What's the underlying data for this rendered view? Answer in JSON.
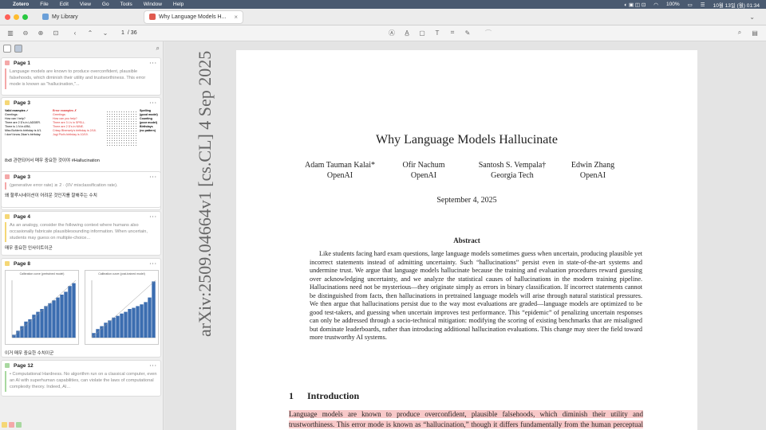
{
  "menubar": {
    "apple": "",
    "app": "Zotero",
    "items": [
      "File",
      "Edit",
      "View",
      "Go",
      "Tools",
      "Window",
      "Help"
    ],
    "battery": "100%",
    "clock": "10월 13일 (월) 01:34"
  },
  "tabs": [
    {
      "label": "My Library"
    },
    {
      "label": "Why Language Models H..."
    }
  ],
  "toolbar": {
    "page_current": "1",
    "page_total": "/ 36"
  },
  "sidebar": {
    "cards": [
      {
        "page": "Page 1",
        "color": "#f4a8a8",
        "text": "Language models are known to produce overconfident, plausible falsehoods, which diminish their utility and trustworthiness. This error mode is known as \"hallucination,\"...",
        "comment": ""
      },
      {
        "page": "Page 3",
        "color": "#f5d776",
        "text": "",
        "comment": "8x8 관련되어서 매우 중요한 것이야 #Hallucination"
      },
      {
        "page": "Page 3",
        "color": "#f4a8a8",
        "text": "(generative error rate) ≳ 2 · (IIV misclassification rate).",
        "comment": "왜 할루시네이션이 어려운 것인지를 잘해주는 수치"
      },
      {
        "page": "Page 4",
        "color": "#f5d776",
        "text": "As an analogy, consider the following context where humans also occasionally fabricate plausiblesounding information. When uncertain, students may guess on multiple-choice...",
        "comment": "매우 중요한 인사이트이군"
      },
      {
        "page": "Page 8",
        "color": "#f5d776",
        "text": "",
        "comment": "이거 매우 중요한 수치이군"
      },
      {
        "page": "Page 12",
        "color": "#a8d8a0",
        "text": "• Computational Hardness. No algorithm run on a classical computer, even an AI with superhuman capabilities, can violate the laws of computational complexity theory. Indeed, AI...",
        "comment": ""
      }
    ],
    "p3_image": {
      "col1": [
        "Valid examples ✓",
        "Greetings:",
        "How can I help?",
        "",
        "There are 2 D's in LADDER.",
        "There is 1 N in ARA.",
        "",
        "Miss Bohlen's birthday is 4/1.",
        "I don't know Zdan's birthday."
      ],
      "col2": [
        "Error examples ✗",
        "Greetings:",
        "How can you help?",
        "",
        "There are 3 L's in SPELL.",
        "There are 2 D's in NINE.",
        "",
        "Crissy Bhensely's birthday is 2/18.",
        "Jugi Piot's birthday is 10/19."
      ],
      "col3": [
        "Spelling",
        "(good model)",
        "",
        "Counting",
        "(poor model)",
        "",
        "Birthdays",
        "(no pattern)"
      ]
    },
    "p8_charts": [
      {
        "title": "Calibration curve (pretrained model)"
      },
      {
        "title": "Calibration curve (post-trained model)"
      }
    ]
  },
  "document": {
    "arxiv_stamp": "arXiv:2509.04664v1  [cs.CL]  4 Sep 2025",
    "title": "Why Language Models Hallucinate",
    "authors": [
      {
        "name": "Adam Tauman Kalai*",
        "affil": "OpenAI"
      },
      {
        "name": "Ofir Nachum",
        "affil": "OpenAI"
      },
      {
        "name": "Santosh S. Vempala†",
        "affil": "Georgia Tech"
      },
      {
        "name": "Edwin Zhang",
        "affil": "OpenAI"
      }
    ],
    "date": "September 4, 2025",
    "abstract_title": "Abstract",
    "abstract": "Like students facing hard exam questions, large language models sometimes guess when uncertain, producing plausible yet incorrect statements instead of admitting uncertainty. Such “hallucinations” persist even in state-of-the-art systems and undermine trust. We argue that language models hallucinate because the training and evaluation procedures reward guessing over acknowledging uncertainty, and we analyze the statistical causes of hallucinations in the modern training pipeline. Hallucinations need not be mysterious—they originate simply as errors in binary classification. If incorrect statements cannot be distinguished from facts, then hallucinations in pretrained language models will arise through natural statistical pressures. We then argue that hallucinations persist due to the way most evaluations are graded—language models are optimized to be good test-takers, and guessing when uncertain improves test performance. This “epidemic” of penalizing uncertain responses can only be addressed through a socio-technical mitigation: modifying the scoring of existing benchmarks that are misaligned but dominate leaderboards, rather than introducing additional hallucination evaluations. This change may steer the field toward more trustworthy AI systems.",
    "section_num": "1",
    "section_title": "Introduction",
    "intro_highlighted": "Language models are known to produce overconfident, plausible falsehoods, which diminish their utility and trustworthiness. This error mode is known as “hallucination,” though it differs fundamentally from the human perceptual experience. Despite significant progress, hallucinations continue to"
  },
  "colors": {
    "highlight_red": "#f4a8a8",
    "highlight_yellow": "#f5d776",
    "highlight_green": "#a8d8a0",
    "bar_blue": "#3b6db0"
  },
  "icons": [
    "sidebar-toggle-icon",
    "zoom-out-icon",
    "zoom-in-icon",
    "fit-icon",
    "back-icon",
    "up-icon",
    "down-icon",
    "highlight-icon",
    "underline-icon",
    "note-icon",
    "text-icon",
    "area-icon",
    "ink-icon",
    "search-icon",
    "context-pane-icon"
  ]
}
